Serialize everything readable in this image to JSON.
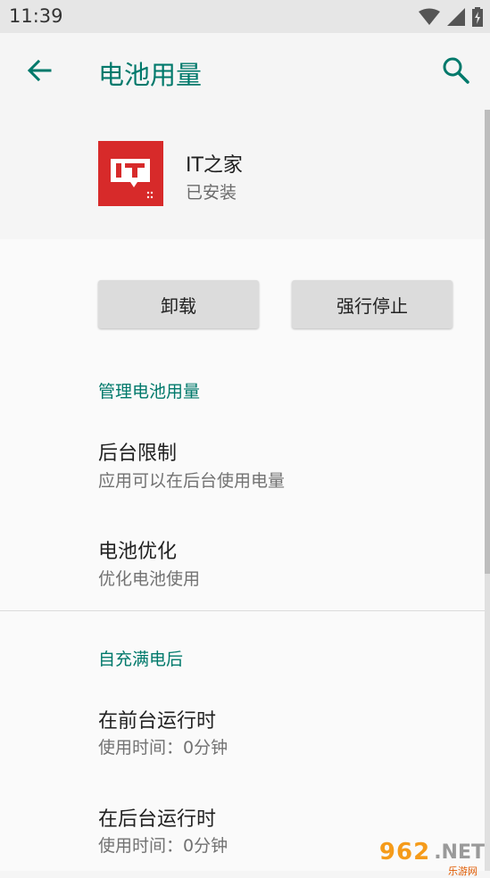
{
  "status_bar": {
    "time": "11:39"
  },
  "app_bar": {
    "title": "电池用量"
  },
  "app_info": {
    "name": "IT之家",
    "status": "已安装"
  },
  "buttons": {
    "uninstall": "卸载",
    "force_stop": "强行停止"
  },
  "sections": {
    "manage": {
      "title": "管理电池用量",
      "items": [
        {
          "title": "后台限制",
          "summary": "应用可以在后台使用电量"
        },
        {
          "title": "电池优化",
          "summary": "优化电池使用"
        }
      ]
    },
    "since_full_charge": {
      "title": "自充满电后",
      "items": [
        {
          "title": "在前台运行时",
          "summary": "使用时间：0分钟"
        },
        {
          "title": "在后台运行时",
          "summary": "使用时间：0分钟"
        }
      ]
    }
  },
  "watermark": {
    "brand": "962",
    "tld": ".NET",
    "sub": "乐游网"
  },
  "colors": {
    "accent": "#00796b",
    "icon_red": "#d72a2a"
  }
}
